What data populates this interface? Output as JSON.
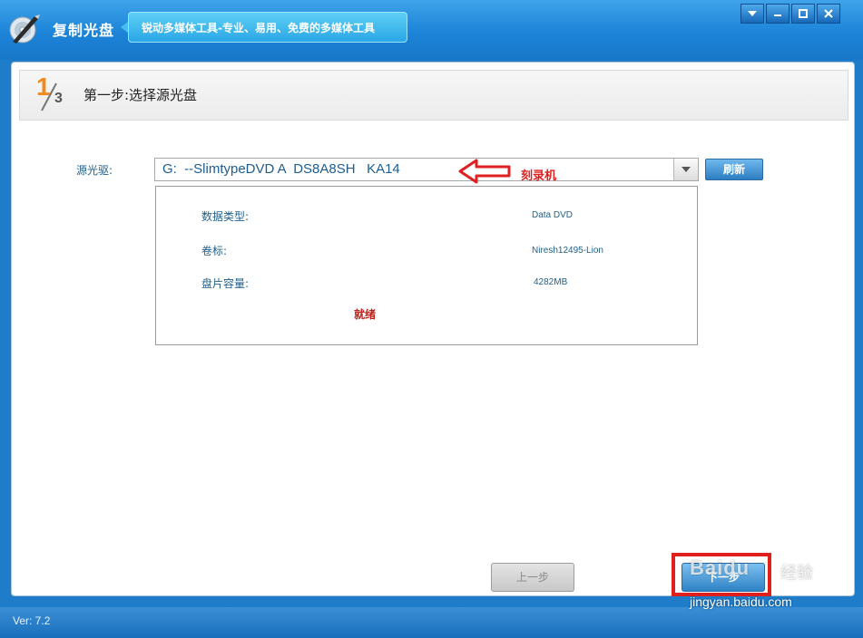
{
  "titlebar": {
    "app_title": "复制光盘",
    "slogan": "锐动多媒体工具-专业、易用、免费的多媒体工具",
    "buttons": [
      "menu",
      "minimize",
      "maximize",
      "close"
    ]
  },
  "step": {
    "current": "1",
    "total": "3",
    "title": "第一步:选择源光盘"
  },
  "source": {
    "label": "源光驱:",
    "selected_drive": "G:  --SlimtypeDVD A  DS8A8SH   KA14",
    "refresh_label": "刷新"
  },
  "annotation": {
    "label": "刻录机"
  },
  "disc_info": {
    "rows": [
      {
        "label": "数据类型:",
        "value": "Data DVD"
      },
      {
        "label": "卷标:",
        "value": "Niresh12495-Lion"
      },
      {
        "label": "盘片容量:",
        "value": "4282MB"
      }
    ],
    "status": "就绪"
  },
  "nav": {
    "prev_label": "上一步",
    "next_label": "下一步"
  },
  "statusbar": {
    "version": "Ver: 7.2"
  },
  "watermark": {
    "brand": "Baidu",
    "cn": "经验",
    "url": "jingyan.baidu.com"
  },
  "colors": {
    "titlebar": "#1c84d8",
    "accent_orange": "#f08a1b",
    "annotation_red": "#e02020",
    "label_blue": "#1f5f8b"
  }
}
